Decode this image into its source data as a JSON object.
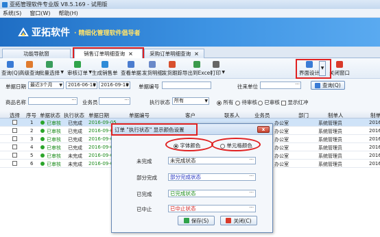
{
  "window": {
    "title": "亚拓管理软件专业版 V8.5.169 - 试用版"
  },
  "menu": [
    "系统(S)",
    "窗口(W)",
    "帮助(H)"
  ],
  "banner": {
    "brand": "亚拓软件",
    "slogan": "· 精细化管理软件倡导者"
  },
  "tabs": [
    {
      "label": "功能导航窗"
    },
    {
      "label": "销售订单明细查询",
      "active": true,
      "close": "×"
    },
    {
      "label": "采购订单明细查询",
      "close": "×"
    }
  ],
  "toolbar": [
    {
      "label": "查询(Q)",
      "dd": false,
      "color": "#3a7bd5"
    },
    {
      "label": "高级查询",
      "dd": false,
      "color": "#e07b2e"
    },
    {
      "label": "批量选择",
      "dd": true,
      "color": "#3a9d5c"
    },
    {
      "label": "审核订单",
      "dd": true,
      "color": "#2fa34a"
    },
    {
      "label": "生成销售单",
      "dd": false,
      "color": "#2e8bd8"
    },
    {
      "label": "查看单据",
      "dd": false,
      "color": "#4b7ccf"
    },
    {
      "label": "发货明细",
      "dd": false,
      "color": "#6a89c9"
    },
    {
      "label": "发货跟踪",
      "dd": false,
      "color": "#d8502e"
    },
    {
      "label": "导出到Excel",
      "dd": false,
      "color": "#3b9a4c"
    },
    {
      "label": "打印",
      "dd": true,
      "color": "#666666"
    },
    {
      "label": "界面设计",
      "dd": false,
      "color": "#3a7bd5"
    },
    {
      "label": "关闭窗口",
      "dd": false,
      "color": "#d93a2a"
    }
  ],
  "filter": {
    "date_label": "单据日期",
    "date_range": "最近3个月",
    "date_from": "2016-06-18",
    "date_to": "2016-09-18",
    "doc_no_label": "单据编号",
    "unit_label": "往来单位",
    "query_button": "查询(Q)",
    "product_label": "商品名称",
    "staff_label": "业务员",
    "exec_label": "执行状态",
    "exec_value": "所有",
    "radios": [
      {
        "label": "所有",
        "on": true
      },
      {
        "label": "待审核",
        "on": false
      },
      {
        "label": "已审核",
        "on": false
      }
    ],
    "red_label": "显示红冲"
  },
  "grid": {
    "headers": [
      "选择",
      "序号",
      "单据状态",
      "执行状态",
      "单据日期",
      "单据编号",
      "客户",
      "联系人",
      "业务员",
      "部门",
      "制单人",
      "制单"
    ],
    "rows": [
      {
        "no": "1",
        "status": "已审核",
        "exec": "已完成",
        "date": "2016-09-05",
        "dept": "办公室",
        "maker": "系统管理员",
        "mdate": "2016-"
      },
      {
        "no": "2",
        "status": "已审核",
        "exec": "已完成",
        "date": "2016-09-05",
        "dept": "办公室",
        "maker": "系统管理员",
        "mdate": "2016-"
      },
      {
        "no": "3",
        "status": "已审核",
        "exec": "已完成",
        "date": "2016-09-05",
        "dept": "办公室",
        "maker": "系统管理员",
        "mdate": "2016-"
      },
      {
        "no": "4",
        "status": "已审核",
        "exec": "已完成",
        "date": "2016-09-05",
        "dept": "办公室",
        "maker": "系统管理员",
        "mdate": "2016-"
      },
      {
        "no": "5",
        "status": "已审核",
        "exec": "未完成",
        "date": "2016-09-05",
        "dept": "办公室",
        "maker": "系统管理员",
        "mdate": "2016-"
      },
      {
        "no": "6",
        "status": "已审核",
        "exec": "未完成",
        "date": "2016-09-05",
        "dept": "办公室",
        "maker": "系统管理员",
        "mdate": "2016-"
      }
    ]
  },
  "dialog": {
    "title": "订单 \"执行状态\" 显示颜色设置",
    "close": "x",
    "radio_font": "字体颜色",
    "radio_cell": "单元格颜色",
    "fields": [
      {
        "label": "未完成",
        "value": "未完成状态",
        "color": "#222222"
      },
      {
        "label": "部分完成",
        "value": "部分完成状态",
        "color": "#2030c0"
      },
      {
        "label": "已完成",
        "value": "已完成状态",
        "color": "#1a8a1a"
      },
      {
        "label": "已中止",
        "value": "已中止状态",
        "color": "#d02020"
      }
    ],
    "save": "保存(S)",
    "cancel": "关闭(C)"
  }
}
